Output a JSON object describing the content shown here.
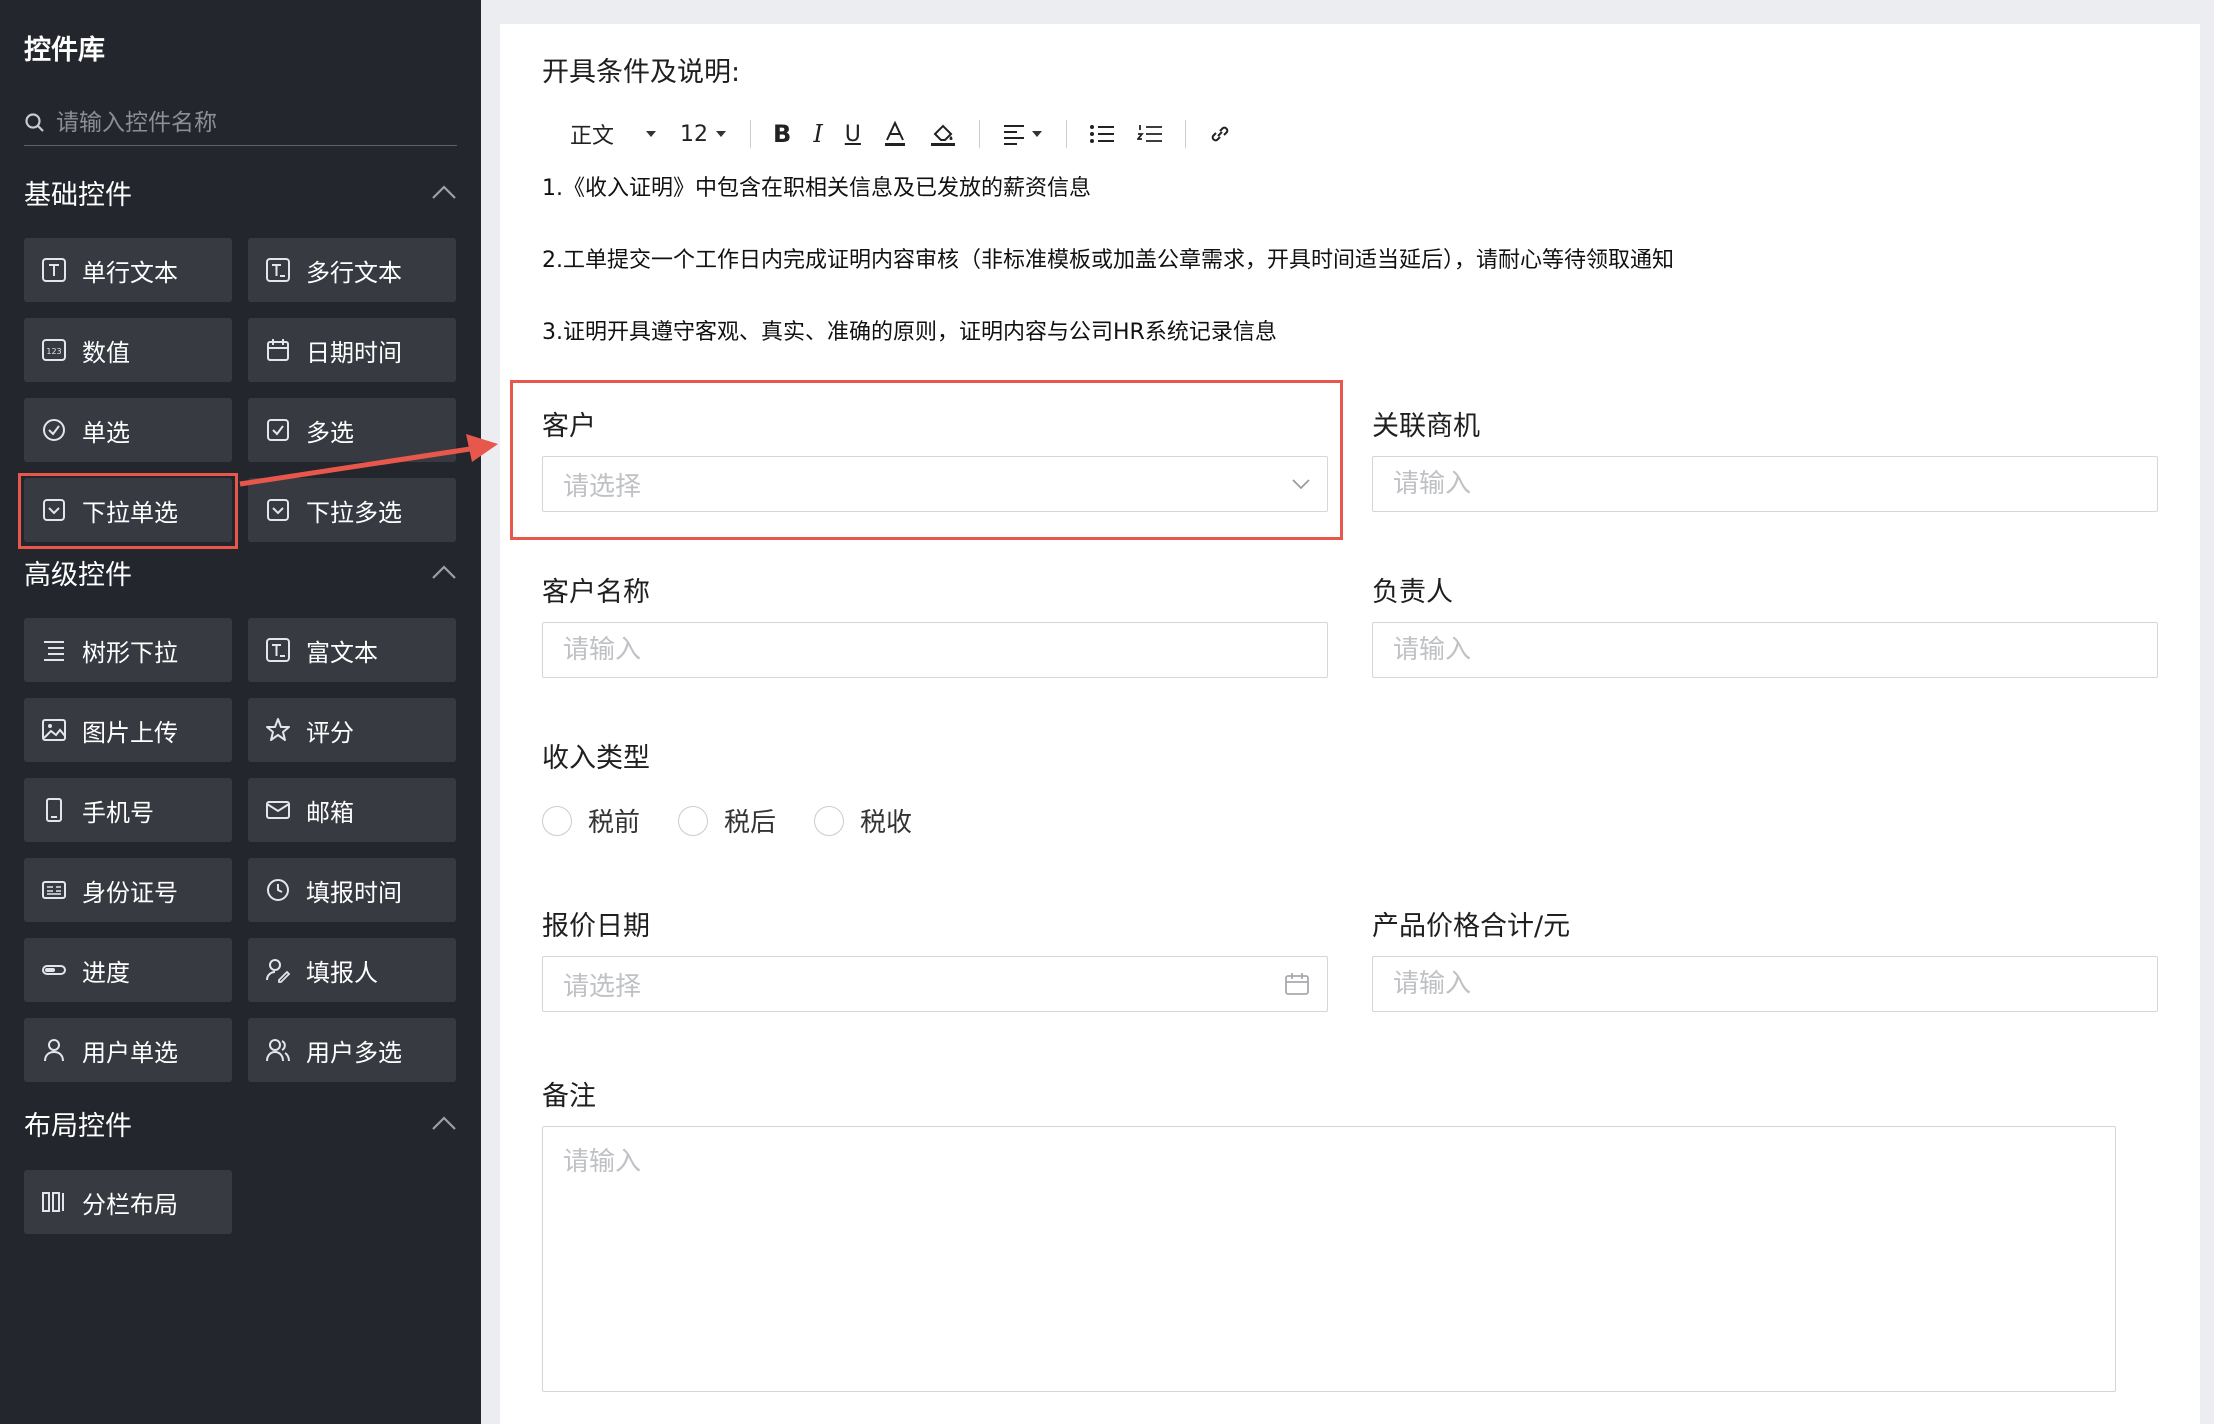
{
  "sidebar": {
    "title": "控件库",
    "search_placeholder": "请输入控件名称",
    "sections": {
      "basic": {
        "title": "基础控件",
        "items": [
          "单行文本",
          "多行文本",
          "数值",
          "日期时间",
          "单选",
          "多选",
          "下拉单选",
          "下拉多选"
        ]
      },
      "advanced": {
        "title": "高级控件",
        "items": [
          "树形下拉",
          "富文本",
          "图片上传",
          "评分",
          "手机号",
          "邮箱",
          "身份证号",
          "填报时间",
          "进度",
          "填报人",
          "用户单选",
          "用户多选"
        ]
      },
      "layout": {
        "title": "布局控件",
        "items": [
          "分栏布局"
        ]
      }
    }
  },
  "main": {
    "section_title": "开具条件及说明:",
    "toolbar": {
      "style": "正文",
      "font_size": "12"
    },
    "paragraphs": [
      "1.《收入证明》中包含在职相关信息及已发放的薪资信息",
      "2.工单提交一个工作日内完成证明内容审核（非标准模板或加盖公章需求，开具时间适当延后），请耐心等待领取通知",
      "3.证明开具遵守客观、真实、准确的原则，证明内容与公司HR系统记录信息"
    ],
    "fields": {
      "customer": {
        "label": "客户",
        "placeholder": "请选择"
      },
      "opportunity": {
        "label": "关联商机",
        "placeholder": "请输入"
      },
      "customer_name": {
        "label": "客户名称",
        "placeholder": "请输入"
      },
      "owner": {
        "label": "负责人",
        "placeholder": "请输入"
      },
      "income_type": {
        "label": "收入类型",
        "options": [
          "税前",
          "税后",
          "税收"
        ]
      },
      "quote_date": {
        "label": "报价日期",
        "placeholder": "请选择"
      },
      "total_price": {
        "label": "产品价格合计/元",
        "placeholder": "请输入"
      },
      "remark": {
        "label": "备注",
        "placeholder": "请输入"
      }
    }
  },
  "colors": {
    "sidebar_bg": "#23262d",
    "tile_bg": "#373a41",
    "highlight": "#e8574c"
  }
}
